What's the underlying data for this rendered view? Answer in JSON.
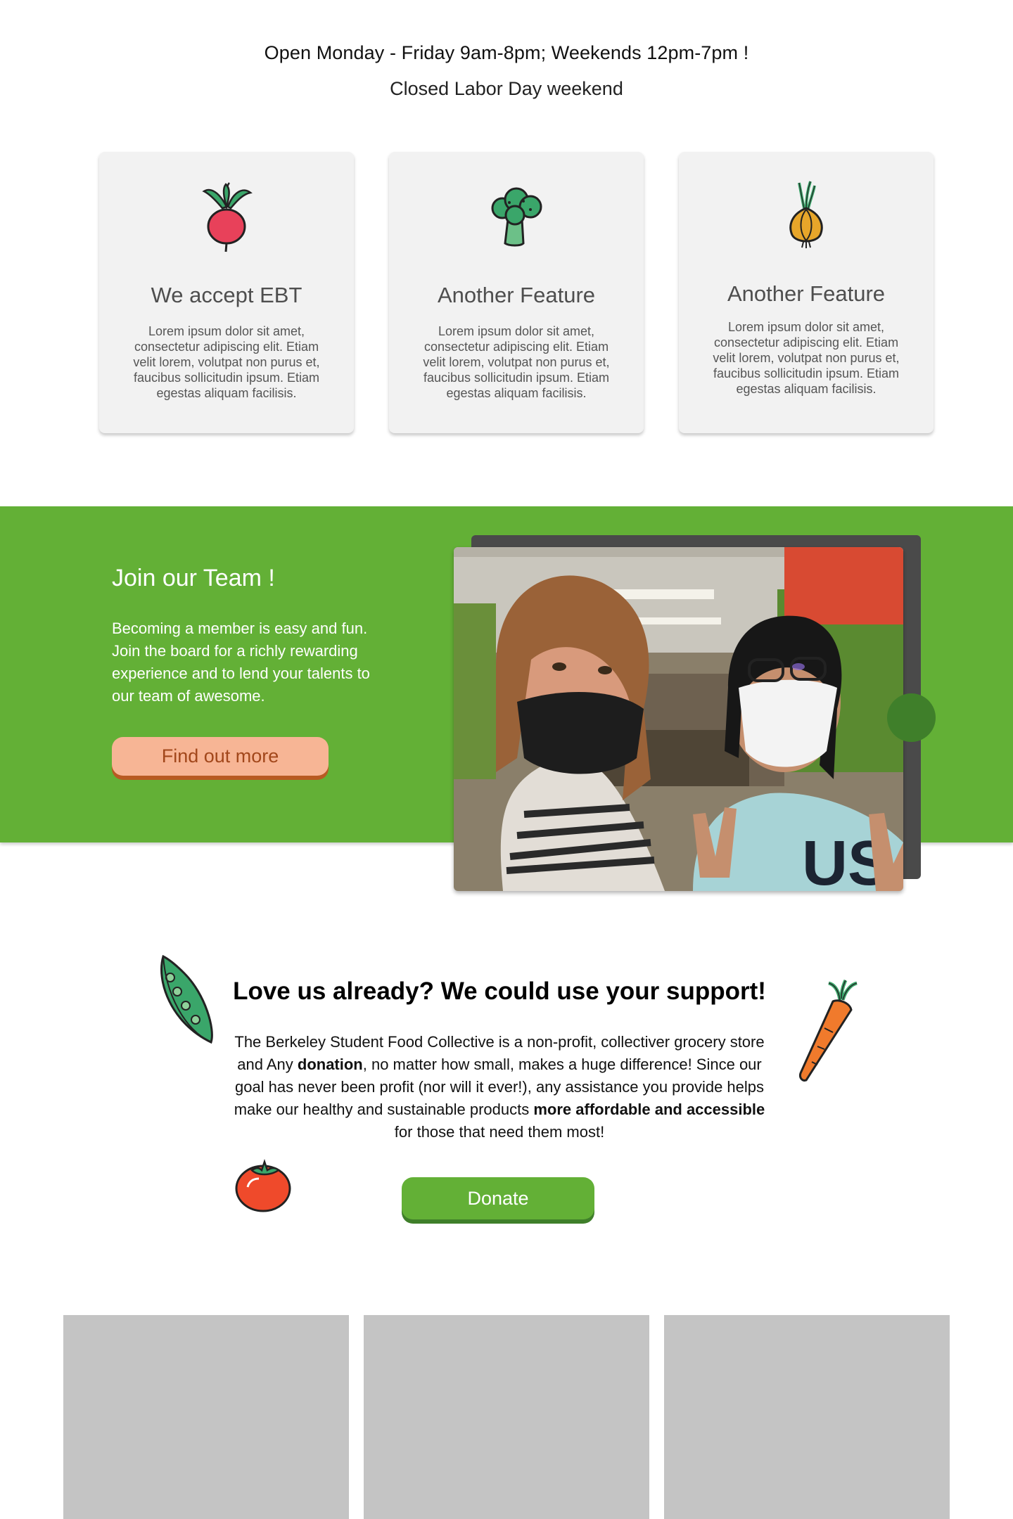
{
  "hours": {
    "line1": "Open Monday - Friday 9am-8pm; Weekends 12pm-7pm !",
    "line2": "Closed Labor Day weekend"
  },
  "features": [
    {
      "title": "We accept EBT",
      "text": "Lorem ipsum dolor sit amet, consectetur adipiscing elit. Etiam velit lorem, volutpat non purus et, faucibus sollicitudin ipsum. Etiam egestas aliquam facilisis.",
      "icon": "radish-icon"
    },
    {
      "title": "Another Feature",
      "text": "Lorem ipsum dolor sit amet, consectetur adipiscing elit. Etiam velit lorem, volutpat non purus et, faucibus sollicitudin ipsum. Etiam egestas aliquam facilisis.",
      "icon": "broccoli-icon"
    },
    {
      "title": "Another Feature",
      "text": "Lorem ipsum dolor sit amet, consectetur adipiscing elit. Etiam velit lorem, volutpat non purus et, faucibus sollicitudin ipsum. Etiam egestas aliquam facilisis.",
      "icon": "onion-icon"
    }
  ],
  "team": {
    "title": "Join our Team !",
    "text": "Becoming a member is easy and fun. Join the board for a richly rewarding experience and to lend your talents to our team of awesome.",
    "button": "Find out more",
    "photo": "two-volunteers-photo"
  },
  "support": {
    "title": "Love us already? We could use your support!",
    "text_parts": [
      "The Berkeley Student Food Collective is a non-profit, collectiver grocery store and Any ",
      "donation",
      ", no matter how small, makes a huge difference! Since our goal has never been profit (nor will it ever!), any assistance you provide helps make our healthy and sustainable products ",
      "more affordable and accessible",
      " for those that need them most!"
    ],
    "button": "Donate",
    "decorations": [
      "pea-pod-icon",
      "carrot-icon",
      "tomato-icon"
    ]
  },
  "colors": {
    "green": "#63b036",
    "dark_green": "#3f7f2a",
    "peach": "#f7b595",
    "card_bg": "#f2f2f2",
    "placeholder": "#c4c4c4"
  }
}
